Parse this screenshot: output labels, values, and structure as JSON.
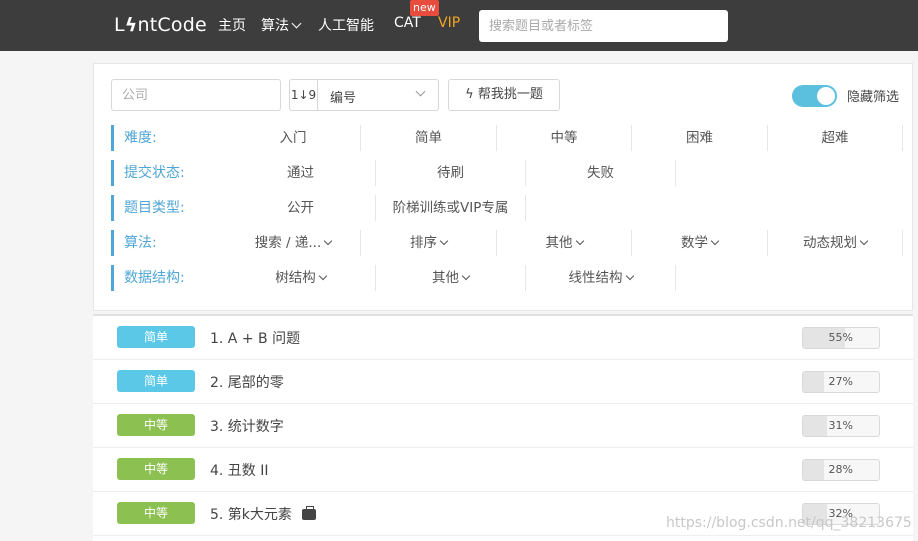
{
  "nav": {
    "logo": "LintCode",
    "logo_left": "L",
    "logo_mid": "ϟ",
    "logo_right": "ntCode",
    "items": [
      "主页",
      "算法",
      "人工智能",
      "CAT",
      "VIP"
    ],
    "new_badge": "new",
    "search_placeholder": "搜索题目或者标签",
    "vip_color": "#f5a623"
  },
  "filters": {
    "company_placeholder": "公司",
    "sort_icon": "1↓9",
    "sort_label": "编号",
    "pick_label": "ϟ 帮我挑一题",
    "toggle_label": "隐藏筛选",
    "toggle_on": true,
    "rows": [
      {
        "label": "难度:",
        "options": [
          "入门",
          "简单",
          "中等",
          "困难",
          "超难"
        ]
      },
      {
        "label": "提交状态:",
        "options": [
          "通过",
          "待刷",
          "失败"
        ]
      },
      {
        "label": "题目类型:",
        "options": [
          "公开",
          "阶梯训练或VIP专属"
        ]
      },
      {
        "label": "算法:",
        "options": [
          "搜索 / 递...",
          "排序",
          "其他",
          "数学",
          "动态规划"
        ]
      },
      {
        "label": "数据结构:",
        "options": [
          "树结构",
          "其他",
          "线性结构"
        ]
      }
    ],
    "accent": "#4fa6d6"
  },
  "problems": [
    {
      "difficulty": "简单",
      "color": "#5bc8e8",
      "title": "1. A + B 问题",
      "rate": "55%",
      "rate_value": 0.55,
      "briefcase": false
    },
    {
      "difficulty": "简单",
      "color": "#5bc8e8",
      "title": "2. 尾部的零",
      "rate": "27%",
      "rate_value": 0.27,
      "briefcase": false
    },
    {
      "difficulty": "中等",
      "color": "#8cc152",
      "title": "3. 统计数字",
      "rate": "31%",
      "rate_value": 0.31,
      "briefcase": false
    },
    {
      "difficulty": "中等",
      "color": "#8cc152",
      "title": "4. 丑数 II",
      "rate": "28%",
      "rate_value": 0.28,
      "briefcase": false
    },
    {
      "difficulty": "中等",
      "color": "#8cc152",
      "title": "5. 第k大元素",
      "rate": "32%",
      "rate_value": 0.32,
      "briefcase": true
    }
  ],
  "watermark": "https://blog.csdn.net/qq_38213675"
}
